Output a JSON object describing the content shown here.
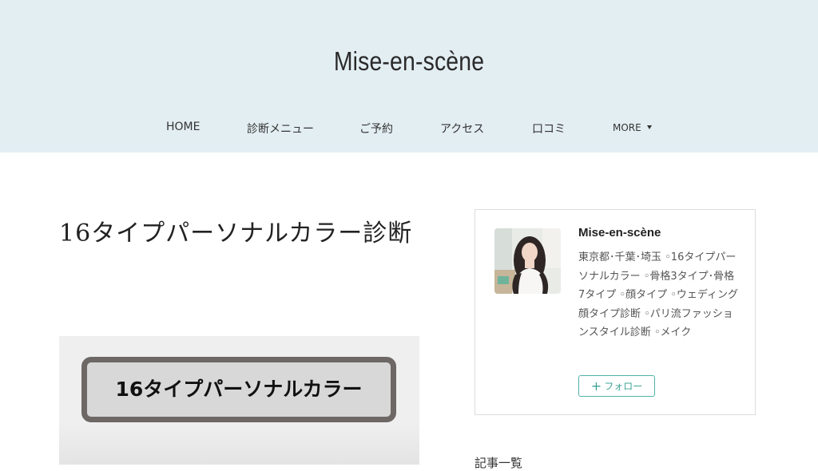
{
  "site": {
    "title": "Mise-en-scène"
  },
  "nav": {
    "items": [
      {
        "label": "HOME"
      },
      {
        "label": "診断メニュー"
      },
      {
        "label": "ご予約"
      },
      {
        "label": "アクセス"
      },
      {
        "label": "口コミ"
      },
      {
        "label": "MORE"
      }
    ]
  },
  "article": {
    "title": "16タイプパーソナルカラー診断",
    "eyecatch_text": "16タイプパーソナルカラー"
  },
  "profile": {
    "name": "Mise-en-scène",
    "bio": "東京都･千葉･埼玉 ◦16タイプパーソナルカラー ◦骨格3タイプ･骨格7タイプ ◦顔タイプ ◦ウェディング顔タイプ診断 ◦パリ流ファッションスタイル診断 ◦メイク",
    "follow_label": "フォロー"
  },
  "sidebar": {
    "heading": "記事一覧"
  },
  "colors": {
    "header_bg": "#e3eef3",
    "follow_accent": "#4fb3a6"
  }
}
